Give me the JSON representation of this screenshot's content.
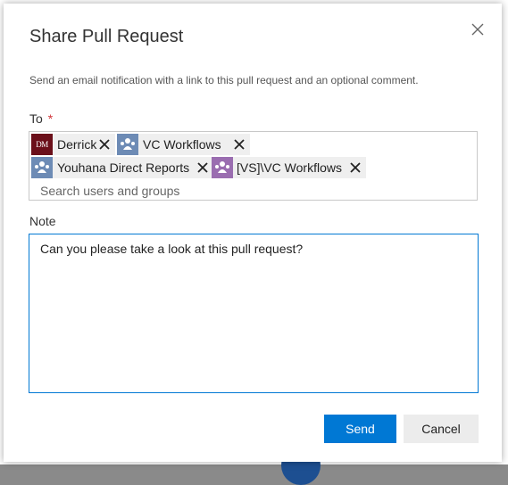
{
  "dialog": {
    "title": "Share Pull Request",
    "description": "Send an email notification with a link to this pull request and an optional comment.",
    "to_label": "To",
    "required_marker": "*",
    "recipients": [
      {
        "name": "Derrick",
        "avatar_text": "DM",
        "avatar_type": "person",
        "avatar_color": "#6b0f1a"
      },
      {
        "name": "VC Workflows",
        "avatar_type": "group",
        "avatar_color": "#6d8bb5"
      },
      {
        "name": "Youhana Direct Reports",
        "avatar_type": "group",
        "avatar_color": "#6d8bb5"
      },
      {
        "name": "[VS]\\VC Workflows",
        "avatar_type": "group",
        "avatar_color": "#9a6db0"
      }
    ],
    "search_placeholder": "Search users and groups",
    "note_label": "Note",
    "note_value": "Can you please take a look at this pull request?",
    "send_label": "Send",
    "cancel_label": "Cancel"
  },
  "colors": {
    "primary": "#0078d4",
    "required": "#d13438"
  }
}
